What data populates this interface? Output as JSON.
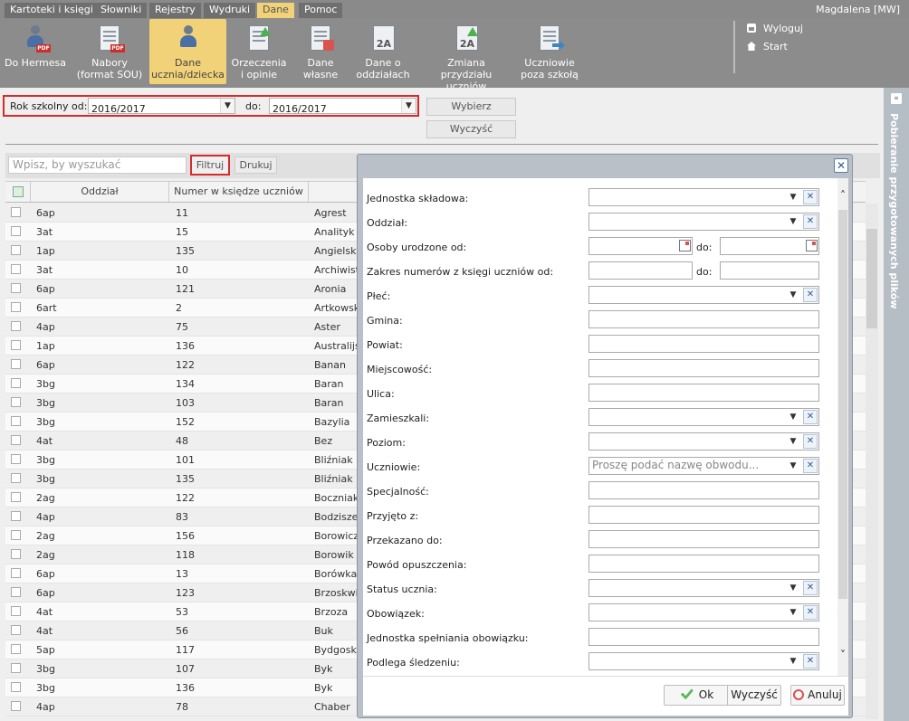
{
  "menu": [
    "Kartoteki i księgi",
    "Słowniki",
    "Rejestry",
    "Wydruki",
    "Dane",
    "Pomoc"
  ],
  "user": "Magdalena [MW]",
  "toolbar": [
    {
      "label": "Do Hermesa",
      "icon": "pdf-person-icon",
      "lines": [
        "Do Hermesa"
      ]
    },
    {
      "label": "Nabory (format SOU)",
      "icon": "pdf-document-icon",
      "lines": [
        "Nabory",
        "(format SOU)"
      ]
    },
    {
      "label": "Dane ucznia/dziecka",
      "icon": "student-icon",
      "lines": [
        "Dane",
        "ucznia/dziecka"
      ],
      "active": true
    },
    {
      "label": "Orzeczenia i opinie",
      "icon": "document-edit-icon",
      "lines": [
        "Orzeczenia",
        "i opinie"
      ]
    },
    {
      "label": "Dane własne",
      "icon": "document-medical-icon",
      "lines": [
        "Dane",
        "własne"
      ]
    },
    {
      "label": "Dane o oddziałach",
      "icon": "class-2a-icon",
      "lines": [
        "Dane o",
        "oddziałach"
      ]
    },
    {
      "label": "Zmiana przydziału uczniów",
      "icon": "class-change-icon",
      "lines": [
        "Zmiana przydziału",
        "uczniów"
      ]
    },
    {
      "label": "Uczniowie poza szkołą",
      "icon": "document-arrow-icon",
      "lines": [
        "Uczniowie",
        "poza szkołą"
      ]
    }
  ],
  "right_links": {
    "logout": "Wyloguj",
    "start": "Start"
  },
  "filter": {
    "label_from": "Rok szkolny od:",
    "from": "2016/2017",
    "label_to": "do:",
    "to": "2016/2017",
    "btn_choose": "Wybierz",
    "btn_clear": "Wyczyść"
  },
  "grid": {
    "search_placeholder": "Wpisz, by wyszukać",
    "btn_filter": "Filtruj",
    "btn_print": "Drukuj",
    "columns": [
      "Oddział",
      "Numer w księdze uczniów"
    ],
    "rows": [
      [
        "6ap",
        "11",
        "Agrest"
      ],
      [
        "3at",
        "15",
        "Analityk"
      ],
      [
        "1ap",
        "135",
        "Angielska"
      ],
      [
        "3at",
        "10",
        "Archiwista"
      ],
      [
        "6ap",
        "121",
        "Aronia"
      ],
      [
        "6art",
        "2",
        "Artkowski"
      ],
      [
        "4ap",
        "75",
        "Aster"
      ],
      [
        "1ap",
        "136",
        "Australijsk"
      ],
      [
        "6ap",
        "122",
        "Banan"
      ],
      [
        "3bg",
        "134",
        "Baran"
      ],
      [
        "3bg",
        "103",
        "Baran"
      ],
      [
        "3bg",
        "152",
        "Bazylia"
      ],
      [
        "4at",
        "48",
        "Bez"
      ],
      [
        "3bg",
        "101",
        "Bliźniak"
      ],
      [
        "3bg",
        "135",
        "Bliźniak"
      ],
      [
        "2ag",
        "122",
        "Boczniak"
      ],
      [
        "4ap",
        "83",
        "Bodziszek"
      ],
      [
        "2ag",
        "156",
        "Borowicz"
      ],
      [
        "2ag",
        "118",
        "Borowik"
      ],
      [
        "6ap",
        "13",
        "Borówka"
      ],
      [
        "6ap",
        "123",
        "Brzoskwin"
      ],
      [
        "4at",
        "53",
        "Brzoza"
      ],
      [
        "4at",
        "56",
        "Buk"
      ],
      [
        "5ap",
        "117",
        "Bydgoska"
      ],
      [
        "3bg",
        "107",
        "Byk"
      ],
      [
        "3bg",
        "136",
        "Byk"
      ],
      [
        "4ap",
        "78",
        "Chaber"
      ]
    ]
  },
  "side_panel": "Pobieranie przygotowanych plików",
  "dialog": {
    "fields": [
      {
        "label": "Jednostka składowa:",
        "type": "select"
      },
      {
        "label": "Oddział:",
        "type": "select"
      },
      {
        "label": "Osoby urodzone od:",
        "type": "date-range",
        "to_label": "do:"
      },
      {
        "label": "Zakres numerów z księgi uczniów od:",
        "type": "text-range",
        "to_label": "do:"
      },
      {
        "label": "Płeć:",
        "type": "select"
      },
      {
        "label": "Gmina:",
        "type": "text"
      },
      {
        "label": "Powiat:",
        "type": "text"
      },
      {
        "label": "Miejscowość:",
        "type": "text"
      },
      {
        "label": "Ulica:",
        "type": "text"
      },
      {
        "label": "Zamieszkali:",
        "type": "select"
      },
      {
        "label": "Poziom:",
        "type": "select"
      },
      {
        "label": "Uczniowie:",
        "type": "select",
        "placeholder": "Proszę podać nazwę obwodu..."
      },
      {
        "label": "Specjalność:",
        "type": "text"
      },
      {
        "label": "Przyjęto z:",
        "type": "text"
      },
      {
        "label": "Przekazano do:",
        "type": "text"
      },
      {
        "label": "Powód opuszczenia:",
        "type": "text"
      },
      {
        "label": "Status ucznia:",
        "type": "select"
      },
      {
        "label": "Obowiązek:",
        "type": "select"
      },
      {
        "label": "Jednostka spełniania obowiązku:",
        "type": "text"
      },
      {
        "label": "Podlega śledzeniu:",
        "type": "select"
      }
    ],
    "btn_ok": "Ok",
    "btn_clear": "Wyczyść",
    "btn_cancel": "Anuluj"
  }
}
